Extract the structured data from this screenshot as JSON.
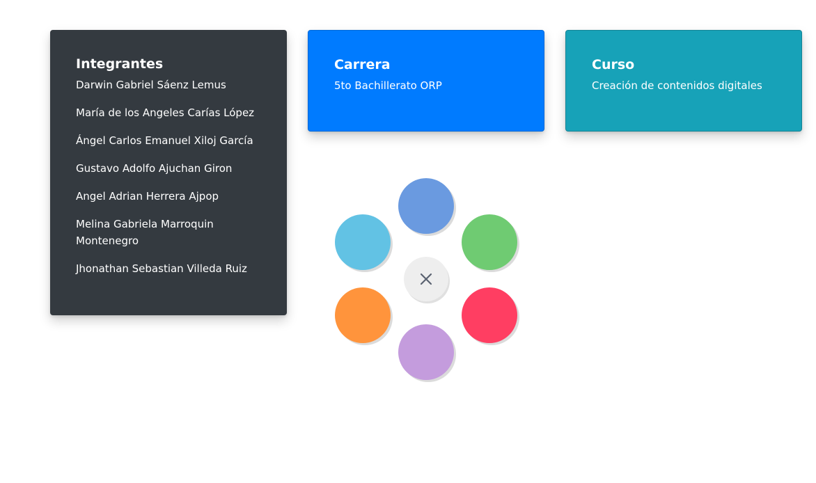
{
  "cards": {
    "members": {
      "title": "Integrantes",
      "items": [
        "Darwin Gabriel Sáenz Lemus",
        "María de los Angeles Carías López",
        "Ángel Carlos Emanuel Xiloj García",
        "Gustavo Adolfo Ajuchan Giron",
        "Angel Adrian Herrera Ajpop",
        "Melina Gabriela Marroquin Montenegro",
        "Jhonathan Sebastian Villeda Ruiz"
      ],
      "color": "#343a40"
    },
    "career": {
      "title": "Carrera",
      "text": "5to Bachillerato ORP",
      "color": "#007bff"
    },
    "course": {
      "title": "Curso",
      "text": "Creación de contenidos digitales",
      "color": "#17a2b8"
    }
  },
  "fab_menu": {
    "close_icon": "close-icon",
    "close_color": "#eeeeee",
    "icon_color": "#5a6270",
    "buttons": [
      {
        "name": "fab-button-blue",
        "color": "#6a9ae0"
      },
      {
        "name": "fab-button-green",
        "color": "#6fcb72"
      },
      {
        "name": "fab-button-red",
        "color": "#ff3e62"
      },
      {
        "name": "fab-button-purple",
        "color": "#c49cdd"
      },
      {
        "name": "fab-button-orange",
        "color": "#ff943c"
      },
      {
        "name": "fab-button-light-blue",
        "color": "#62c2e4"
      }
    ]
  }
}
